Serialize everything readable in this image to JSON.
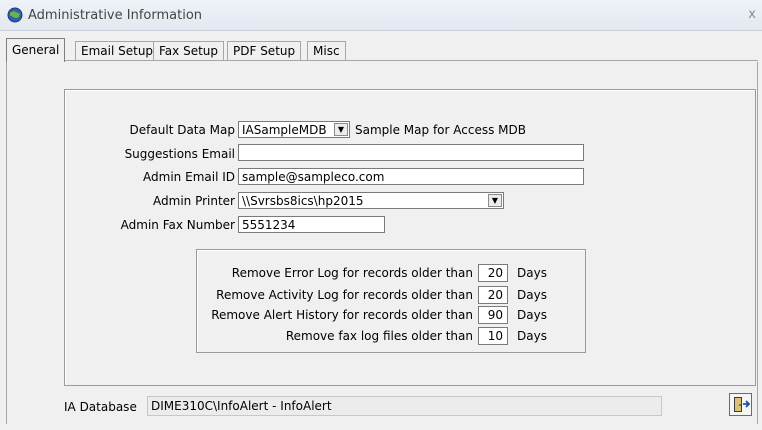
{
  "window": {
    "title": "Administrative Information",
    "close_label": "x"
  },
  "tabs": [
    {
      "label": "General",
      "active": true
    },
    {
      "label": "Email Setup"
    },
    {
      "label": "Fax Setup"
    },
    {
      "label": "PDF Setup"
    },
    {
      "label": "Misc"
    }
  ],
  "form": {
    "default_data_map": {
      "label": "Default Data Map",
      "value": "IASampleMDB",
      "description": "Sample Map for Access MDB"
    },
    "suggestions_email": {
      "label": "Suggestions Email",
      "value": ""
    },
    "admin_email_id": {
      "label": "Admin Email ID",
      "value": "sample@sampleco.com"
    },
    "admin_printer": {
      "label": "Admin Printer",
      "value": "\\\\Svrsbs8ics\\hp2015"
    },
    "admin_fax_number": {
      "label": "Admin Fax Number",
      "value": "5551234"
    }
  },
  "retention": {
    "days_label": "Days",
    "rows": [
      {
        "label": "Remove Error Log for records older than",
        "value": "20"
      },
      {
        "label": "Remove Activity Log for records older than",
        "value": "20"
      },
      {
        "label": "Remove Alert History for records older than",
        "value": "90"
      },
      {
        "label": "Remove fax log files older than",
        "value": "10"
      }
    ]
  },
  "status": {
    "label": "IA Database",
    "value": "DIME310C\\InfoAlert - InfoAlert"
  },
  "icons": {
    "app": "app-globe-icon",
    "exit": "exit-door-icon"
  },
  "colors": {
    "window_bg": "#f0f0f0",
    "titlebar": "#e3e8f0",
    "field_bg": "#ffffff"
  }
}
